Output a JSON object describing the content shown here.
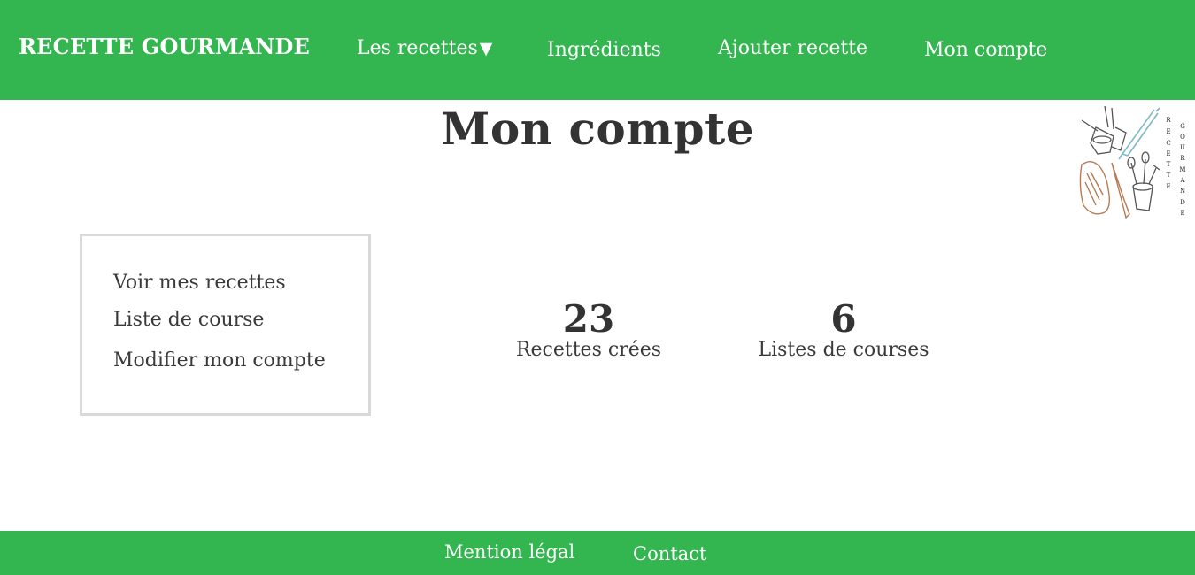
{
  "header": {
    "brand": "RECETTE GOURMANDE",
    "nav": {
      "recettes": "Les recettes",
      "recettes_caret": "▼",
      "ingredients": "Ingrédients",
      "ajouter": "Ajouter recette",
      "compte": "Mon compte"
    }
  },
  "main": {
    "title": "Mon compte",
    "menu": [
      "Voir mes recettes",
      "Liste de course",
      "Modifier mon compte"
    ],
    "stats": [
      {
        "value": "23",
        "label": "Recettes crées"
      },
      {
        "value": "6",
        "label": "Listes de courses"
      }
    ]
  },
  "logo": {
    "word1": "RECETTE",
    "word2": "GOURMANDE"
  },
  "footer": {
    "mention": "Mention légal",
    "contact": "Contact"
  },
  "colors": {
    "brand_green": "#33b550",
    "text_dark": "#333333",
    "box_border": "#d9d9d9"
  }
}
